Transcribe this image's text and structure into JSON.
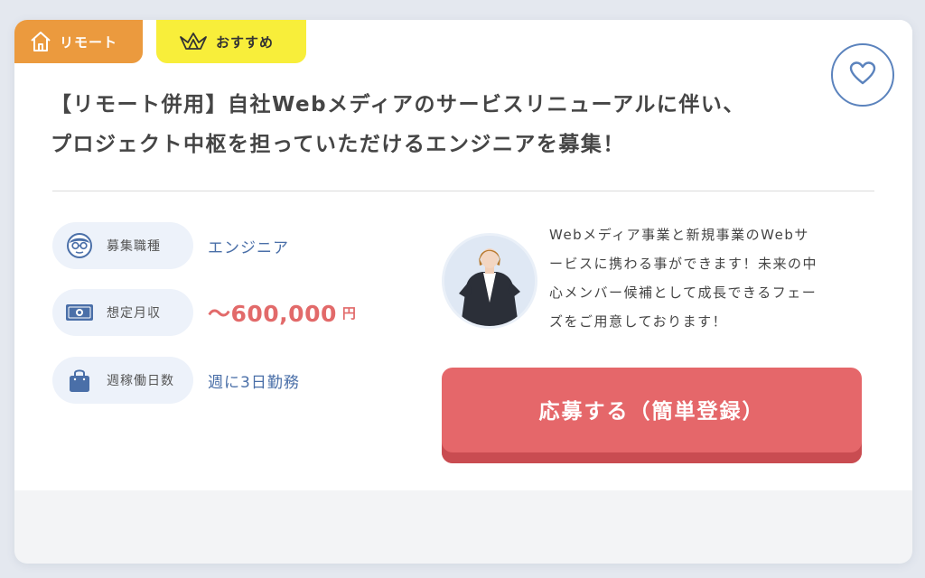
{
  "tags": {
    "remote": "リモート",
    "recommend": "おすすめ"
  },
  "favorite_icon": "heart-icon",
  "job": {
    "title_line1": "【リモート併用】自社Webメディアのサービスリニューアルに伴い、",
    "title_line2": "プロジェクト中枢を担っていただけるエンジニアを募集！"
  },
  "info": {
    "job_type": {
      "label": "募集職種",
      "value": "エンジニア",
      "icon": "person-glasses-icon"
    },
    "salary": {
      "label": "想定月収",
      "value": "〜600,000",
      "unit": "円",
      "icon": "money-icon"
    },
    "workdays": {
      "label": "週稼働日数",
      "value": "週に3日勤務",
      "icon": "bag-icon"
    }
  },
  "description": {
    "line1": "Webメディア事業と新規事業のWebサ",
    "line2": "ービスに携わる事ができます！未来の中",
    "line3": "心メンバー候補として成長できるフェー",
    "line4": "ズをご用意しております！"
  },
  "apply_button": "応募する（簡単登録）",
  "colors": {
    "remote_tag": "#eb9a3e",
    "recommend_tag": "#f8ee3a",
    "accent_blue": "#4a6fa8",
    "salary_red": "#e26a6a",
    "apply_button": "#e5676a",
    "pill_bg": "#edf2fa"
  }
}
